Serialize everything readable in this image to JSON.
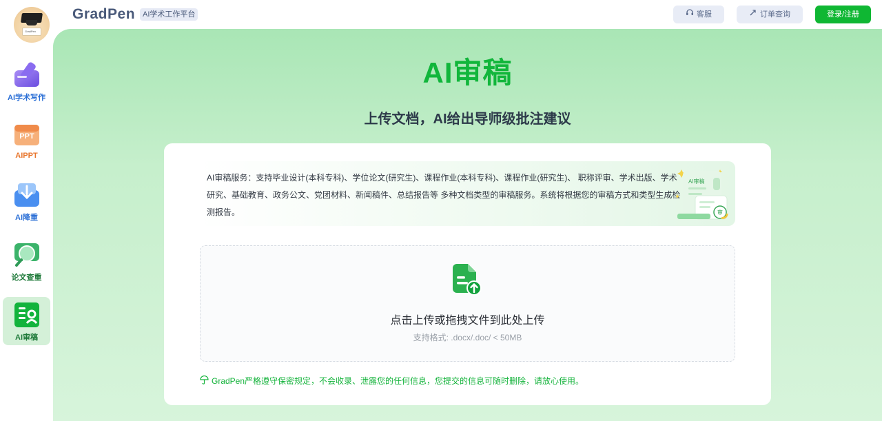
{
  "brand": {
    "name": "GradPen",
    "tag": "AI学术工作平台"
  },
  "header": {
    "service_label": "客服",
    "order_label": "订单查询",
    "login_label": "登录/注册"
  },
  "sidebar": {
    "items": [
      {
        "label": "AI学术写作",
        "color": "#2b6fd6",
        "icon": "pen-icon"
      },
      {
        "label": "AIPPT",
        "color": "#e8762d",
        "icon": "ppt-icon"
      },
      {
        "label": "AI降重",
        "color": "#2b6fd6",
        "icon": "download-icon"
      },
      {
        "label": "论文查重",
        "color": "#1f7a3a",
        "icon": "magnifier-icon"
      },
      {
        "label": "AI审稿",
        "color": "#1f7a3a",
        "icon": "review-icon",
        "active": true
      }
    ]
  },
  "main": {
    "title": "AI审稿",
    "subtitle": "上传文档，AI给出导师级批注建议",
    "info_text": "AI审稿服务：支持毕业设计(本科专科)、学位论文(研究生)、课程作业(本科专科)、课程作业(研究生)、 职称评审、学术出版、学术研究、基础教育、政务公文、党团材料、新闻稿件、总结报告等 多种文档类型的审稿服务。系统将根据您的审稿方式和类型生成检测报告。",
    "illus_label": "AI审稿",
    "illus_badge": "审",
    "upload_title": "点击上传或拖拽文件到此处上传",
    "upload_hint": "支持格式: .docx/.doc/ < 50MB",
    "notice": "GradPen严格遵守保密规定，不会收录、泄露您的任何信息，您提交的信息可随时删除，请放心使用。"
  },
  "avatar_text": "GradPen"
}
